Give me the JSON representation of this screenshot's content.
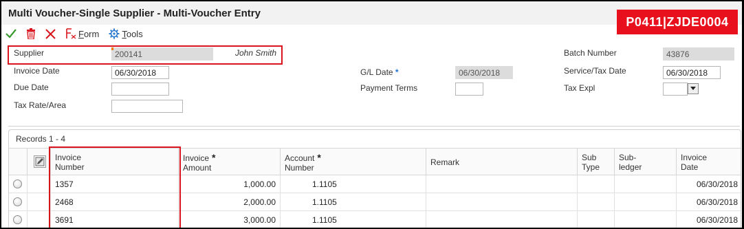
{
  "window": {
    "title": "Multi Voucher-Single Supplier - Multi-Voucher Entry",
    "badge": "P0411|ZJDE0004"
  },
  "toolbar": {
    "ok_icon": "checkmark-icon",
    "delete_icon": "trash-icon",
    "cancel_icon": "close-icon",
    "form_label_first": "F",
    "form_label_rest": "orm",
    "tools_label_first": "T",
    "tools_label_rest": "ools"
  },
  "form": {
    "supplier": {
      "label": "Supplier",
      "value": "200141",
      "name": "John Smith"
    },
    "batch_number": {
      "label": "Batch Number",
      "value": "43876"
    },
    "invoice_date": {
      "label": "Invoice Date",
      "value": "06/30/2018"
    },
    "gl_date": {
      "label": "G/L Date",
      "required_mark": "*",
      "value": "06/30/2018"
    },
    "service_tax_date": {
      "label": "Service/Tax Date",
      "value": "06/30/2018"
    },
    "due_date": {
      "label": "Due Date",
      "value": ""
    },
    "payment_terms": {
      "label": "Payment Terms",
      "value": ""
    },
    "tax_expl": {
      "label": "Tax Expl",
      "value": ""
    },
    "tax_rate_area": {
      "label": "Tax Rate/Area",
      "value": ""
    }
  },
  "grid": {
    "records_label": "Records 1 - 4",
    "columns": [
      {
        "line1": "Invoice",
        "line2": "Number",
        "star": ""
      },
      {
        "line1": "Invoice",
        "line2": "Amount",
        "star": "*"
      },
      {
        "line1": "Account",
        "line2": "Number",
        "star": "*"
      },
      {
        "line1": "Remark",
        "line2": "",
        "star": ""
      },
      {
        "line1": "Sub",
        "line2": "Type",
        "star": ""
      },
      {
        "line1": "Sub-",
        "line2": "ledger",
        "star": ""
      },
      {
        "line1": "Invoice",
        "line2": "Date",
        "star": ""
      }
    ],
    "rows": [
      {
        "invoice_number": "1357",
        "invoice_amount": "1,000.00",
        "account_number": "1.1105",
        "remark": "",
        "sub_type": "",
        "subledger": "",
        "invoice_date": "06/30/2018"
      },
      {
        "invoice_number": "2468",
        "invoice_amount": "2,000.00",
        "account_number": "1.1105",
        "remark": "",
        "sub_type": "",
        "subledger": "",
        "invoice_date": "06/30/2018"
      },
      {
        "invoice_number": "3691",
        "invoice_amount": "3,000.00",
        "account_number": "1.1105",
        "remark": "",
        "sub_type": "",
        "subledger": "",
        "invoice_date": "06/30/2018"
      }
    ]
  },
  "colors": {
    "highlight": "#d9141c",
    "badge": "#e8101c",
    "required_star": "#1a73d9"
  }
}
